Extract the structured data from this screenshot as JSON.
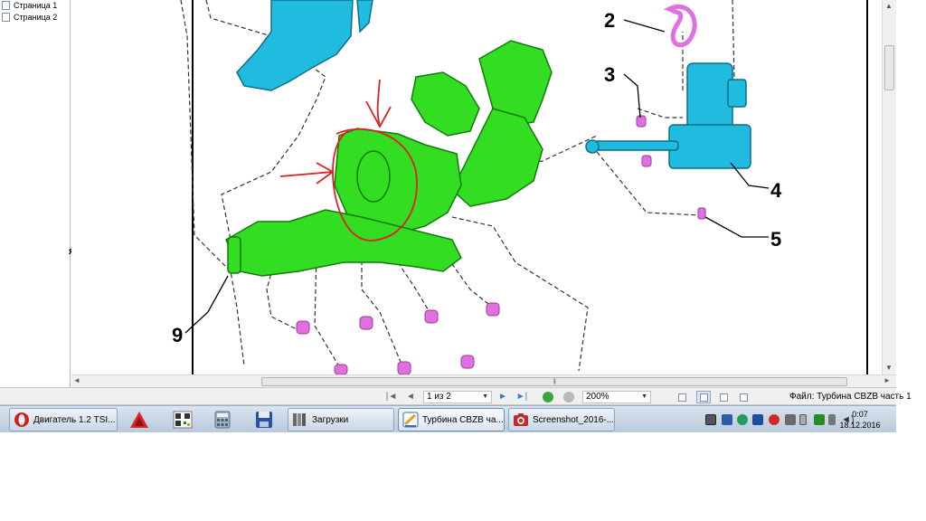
{
  "pages_panel": {
    "items": [
      {
        "label": "Страница 1"
      },
      {
        "label": "Страница 2"
      }
    ],
    "fragment": "я"
  },
  "drawing": {
    "callouts": [
      "2",
      "3",
      "4",
      "5",
      "9"
    ],
    "colors": {
      "turbo": "#33dd22",
      "manifold_top": "#22bbe0",
      "actuator": "#22bbe0",
      "small_parts": "#e070e0",
      "annotation": "#e02020"
    }
  },
  "toolbar": {
    "first_icon": "first-page-icon",
    "prev_icon": "prev-page-icon",
    "page_indicator": "1 из 2",
    "next_icon": "next-page-icon",
    "last_icon": "last-page-icon",
    "back_icon": "back-icon",
    "forward_icon": "forward-icon",
    "zoom": "200%",
    "file_label": "Файл: Турбина CBZB часть 1"
  },
  "taskbar": {
    "tasks": [
      {
        "label": "Двигатель 1.2 TSI...",
        "icon": "opera-icon"
      },
      {
        "label": "Загрузки",
        "icon": "folder-icon"
      },
      {
        "label": "Турбина CBZB ча...",
        "icon": "document-viewer-icon"
      },
      {
        "label": "Screenshot_2016-...",
        "icon": "camera-icon"
      }
    ],
    "pinned": [
      "autocad-icon",
      "qr-code-icon",
      "calculator-icon",
      "floppy-save-icon"
    ],
    "clock": {
      "time": "0:07",
      "date": "18.12.2016"
    }
  }
}
